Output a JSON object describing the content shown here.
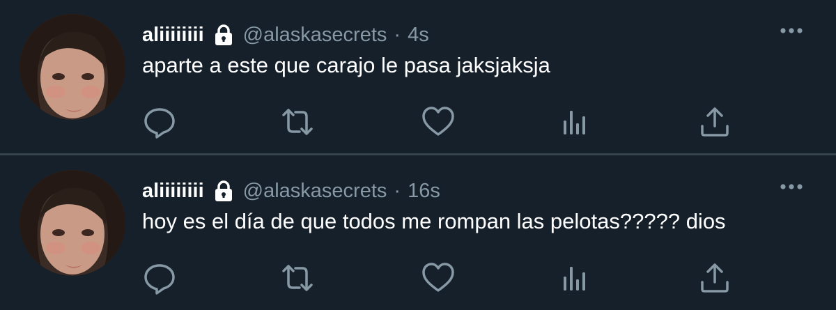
{
  "tweets": [
    {
      "name": "aliiiiiiii",
      "handle": "@alaskasecrets",
      "separator": "·",
      "time": "4s",
      "text": "aparte a este que carajo le pasa jaksjaksja"
    },
    {
      "name": "aliiiiiiii",
      "handle": "@alaskasecrets",
      "separator": "·",
      "time": "16s",
      "text": "hoy es el día de que todos me rompan las pelotas????? dios"
    }
  ],
  "icons": {
    "protected": "lock-icon",
    "more": "more-icon",
    "reply": "reply-icon",
    "retweet": "retweet-icon",
    "like": "like-icon",
    "analytics": "analytics-icon",
    "share": "share-icon"
  },
  "colors": {
    "background": "#15202b",
    "text": "#ffffff",
    "secondary": "#8899a6",
    "divider": "#38444d"
  }
}
